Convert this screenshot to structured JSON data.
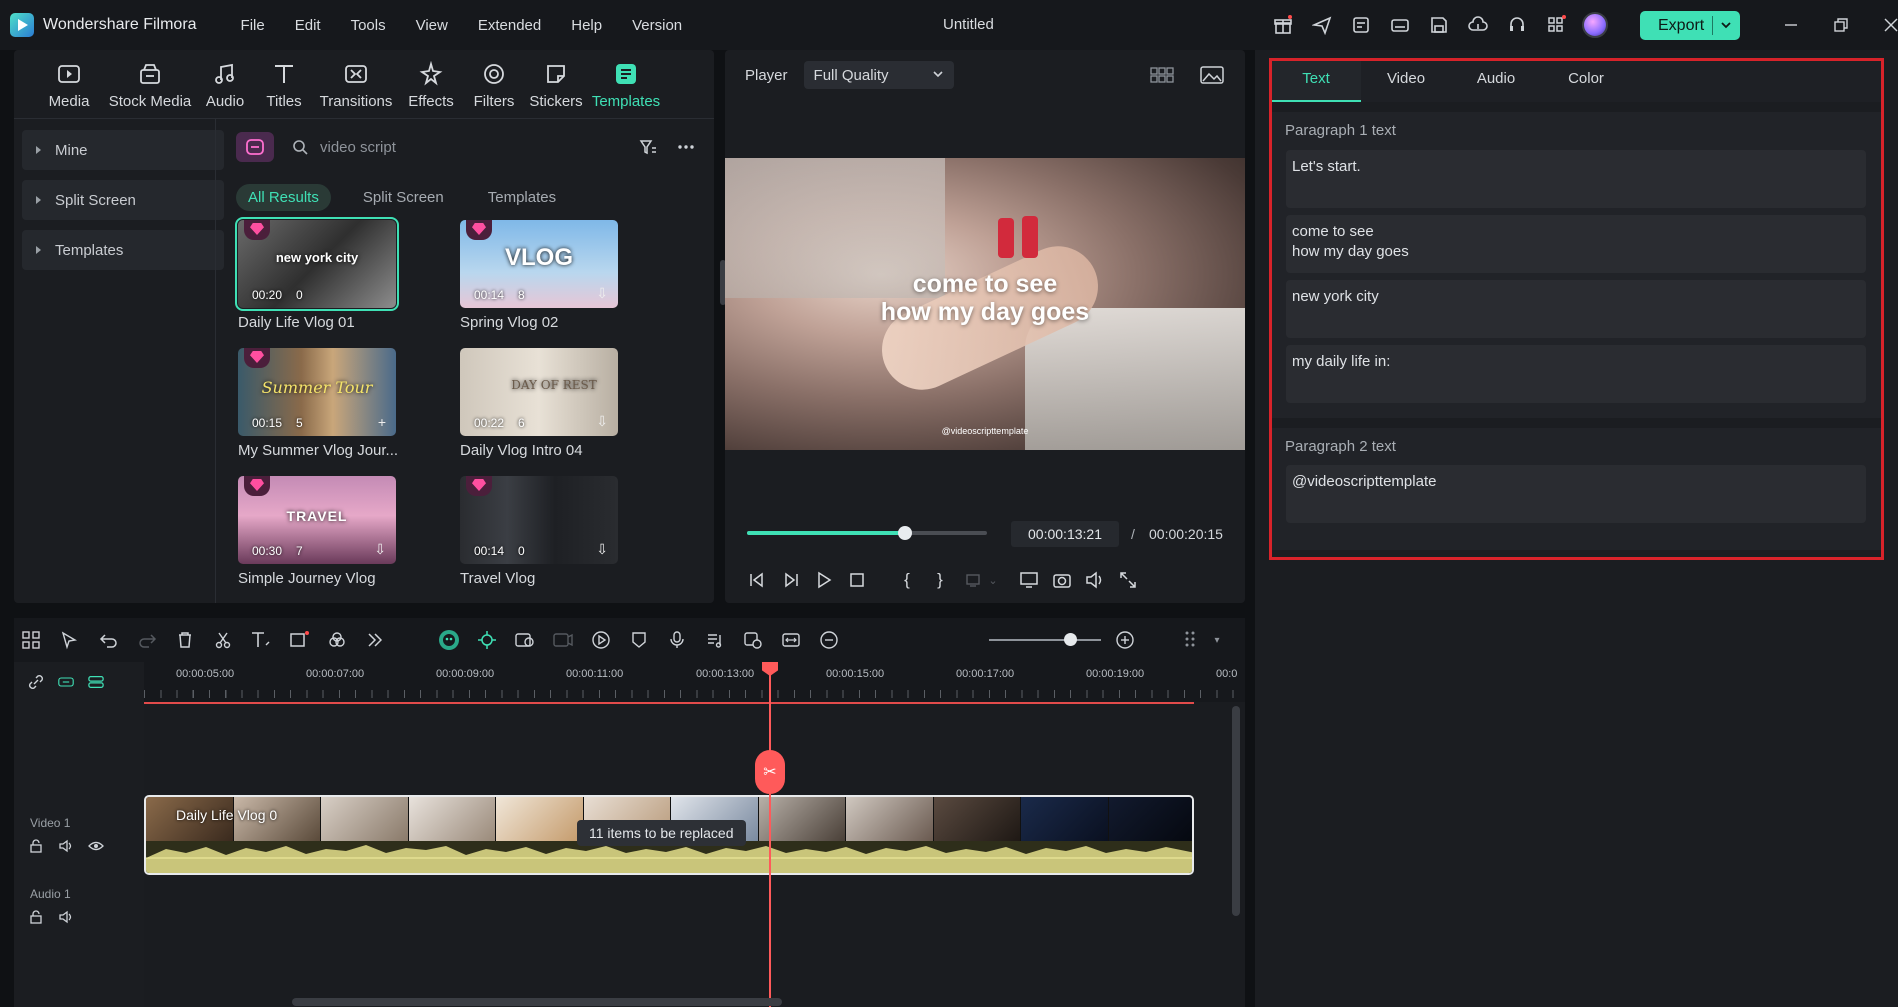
{
  "app": {
    "name": "Wondershare Filmora",
    "document_title": "Untitled",
    "menu": [
      "File",
      "Edit",
      "Tools",
      "View",
      "Extended",
      "Help",
      "Version"
    ],
    "export_label": "Export",
    "accent_color": "#3fe0b5"
  },
  "media_panel": {
    "tool_tabs": [
      {
        "label": "Media",
        "icon": "media-icon"
      },
      {
        "label": "Stock Media",
        "icon": "stock-media-icon"
      },
      {
        "label": "Audio",
        "icon": "audio-icon"
      },
      {
        "label": "Titles",
        "icon": "titles-icon"
      },
      {
        "label": "Transitions",
        "icon": "transitions-icon"
      },
      {
        "label": "Effects",
        "icon": "effects-icon"
      },
      {
        "label": "Filters",
        "icon": "filters-icon"
      },
      {
        "label": "Stickers",
        "icon": "stickers-icon"
      },
      {
        "label": "Templates",
        "icon": "templates-icon",
        "active": true
      }
    ],
    "tree": [
      "Mine",
      "Split Screen",
      "Templates"
    ],
    "search_value": "video script",
    "filter_tabs": [
      {
        "label": "All Results",
        "active": true
      },
      {
        "label": "Split Screen"
      },
      {
        "label": "Templates"
      }
    ],
    "items": [
      {
        "name": "Daily Life Vlog 01",
        "duration": "00:20",
        "count": "0",
        "thumb_text": "new york city",
        "selected": true
      },
      {
        "name": "Spring Vlog 02",
        "duration": "00:14",
        "count": "8",
        "thumb_text": "VLOG"
      },
      {
        "name": "My Summer Vlog Jour...",
        "duration": "00:15",
        "count": "5",
        "thumb_text": "Summer Tour"
      },
      {
        "name": "Daily Vlog Intro 04",
        "duration": "00:22",
        "count": "6",
        "thumb_text": "DAY OF REST"
      },
      {
        "name": "Simple Journey Vlog",
        "duration": "00:30",
        "count": "7",
        "thumb_text": "TRAVEL"
      },
      {
        "name": "Travel Vlog",
        "duration": "00:14",
        "count": "0",
        "thumb_text": ""
      }
    ]
  },
  "player": {
    "label": "Player",
    "quality": "Full Quality",
    "overlay_line1": "come to see",
    "overlay_line2": "how my day goes",
    "overlay_handle": "@videoscripttemplate",
    "current_time": "00:00:13:21",
    "total_time": "00:00:20:15",
    "progress_fraction": 0.66
  },
  "inspector": {
    "tabs": [
      {
        "label": "Text",
        "active": true
      },
      {
        "label": "Video"
      },
      {
        "label": "Audio"
      },
      {
        "label": "Color"
      }
    ],
    "paragraph1_title": "Paragraph 1 text",
    "paragraph1_fields": [
      "Let's start.",
      "come to see\nhow my day goes",
      "new york city",
      "my daily life in:"
    ],
    "paragraph2_title": "Paragraph 2 text",
    "paragraph2_fields": [
      "@videoscripttemplate"
    ],
    "highlight_color": "#d8232a"
  },
  "timeline": {
    "ruler_labels": [
      "00:00:05:00",
      "00:00:07:00",
      "00:00:09:00",
      "00:00:11:00",
      "00:00:13:00",
      "00:00:15:00",
      "00:00:17:00",
      "00:00:19:00",
      "00:0"
    ],
    "tracks": [
      {
        "label": "Video 1"
      },
      {
        "label": "Audio 1"
      }
    ],
    "clip_title": "Daily Life Vlog 0",
    "tooltip": "11 items to be replaced"
  }
}
